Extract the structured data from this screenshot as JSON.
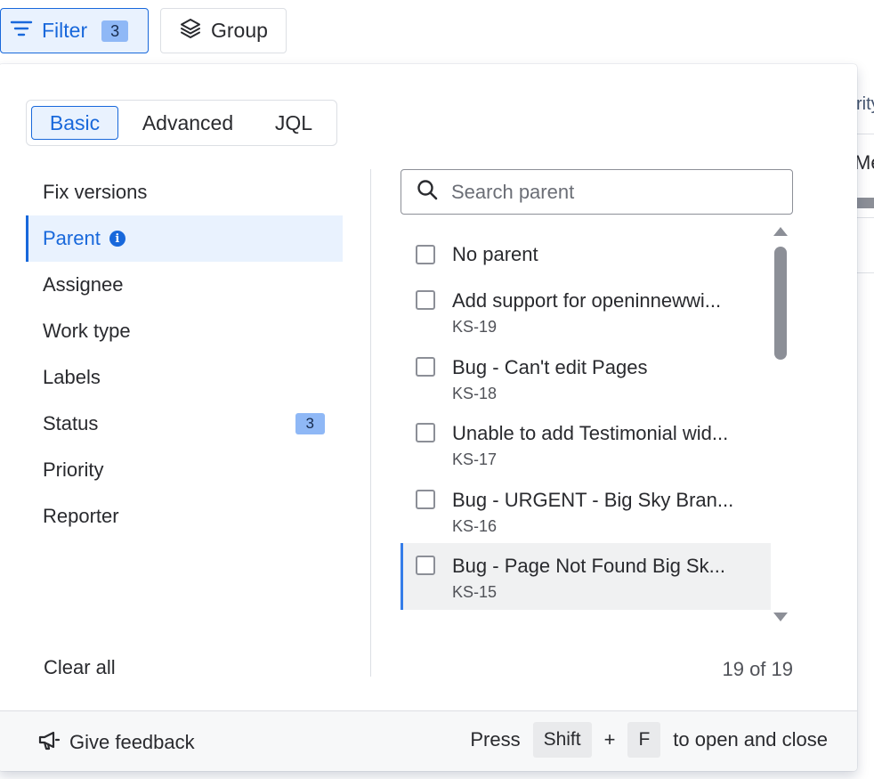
{
  "toolbar": {
    "filter_label": "Filter",
    "filter_count": "3",
    "group_label": "Group"
  },
  "background": {
    "column_header": "rity",
    "cell_value": "Me"
  },
  "mode_tabs": [
    {
      "label": "Basic",
      "active": true
    },
    {
      "label": "Advanced",
      "active": false
    },
    {
      "label": "JQL",
      "active": false
    }
  ],
  "fields": [
    {
      "label": "Fix versions"
    },
    {
      "label": "Parent",
      "selected": true,
      "info": true
    },
    {
      "label": "Assignee"
    },
    {
      "label": "Work type"
    },
    {
      "label": "Labels"
    },
    {
      "label": "Status",
      "badge": "3"
    },
    {
      "label": "Priority"
    },
    {
      "label": "Reporter"
    }
  ],
  "clear_all": "Clear all",
  "search": {
    "placeholder": "Search parent",
    "value": ""
  },
  "options": [
    {
      "title": "No parent"
    },
    {
      "title": "Add support for openinnewwi...",
      "key": "KS-19"
    },
    {
      "title": "Bug - Can't edit Pages",
      "key": "KS-18"
    },
    {
      "title": "Unable to add Testimonial wid...",
      "key": "KS-17"
    },
    {
      "title": "Bug - URGENT - Big Sky Bran...",
      "key": "KS-16"
    },
    {
      "title": "Bug - Page Not Found Big Sk...",
      "key": "KS-15"
    }
  ],
  "result_count": "19 of 19",
  "footer": {
    "feedback_label": "Give feedback",
    "press_label": "Press",
    "key1": "Shift",
    "plus": "+",
    "key2": "F",
    "suffix": "to open and close"
  },
  "colors": {
    "accent": "#1868db",
    "accent_bg": "#e9f2fe",
    "badge_bg": "#8fb8f6"
  }
}
